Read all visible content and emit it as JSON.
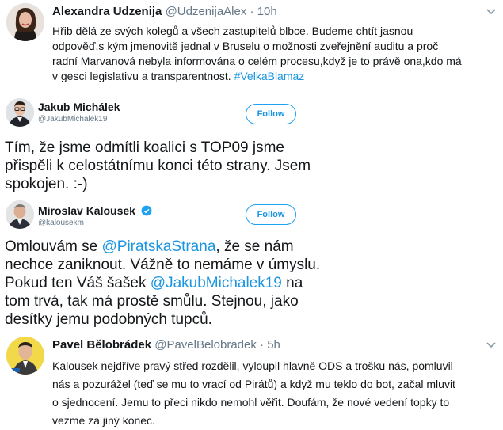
{
  "tweets": [
    {
      "name": "Alexandra Udzenija",
      "handle": "@UdzenijaAlex",
      "sep": "·",
      "time": "10h",
      "lines": [
        "Hřib dělá ze svých kolegů a všech zastupitelů blbce. Budeme chtít jasnou",
        "odpověď,s kým jmenovitě jednal v Bruselu o možnosti zveřejnění auditu a proč",
        "radní Marvanová nebyla informována o celém procesu,když je to právě ona,kdo má"
      ],
      "last_line_pre": "v gesci legislativu a transparentnost. ",
      "hashtag": "#VelkaBlamaz"
    },
    {
      "name": "Jakub Michálek",
      "handle": "@JakubMichalek19",
      "follow": "Follow",
      "lines": [
        "Tím, že jsme odmítli koalici s TOP09 jsme",
        "přispěli k celostátnímu konci této strany. Jsem",
        "spokojen. :-)"
      ]
    },
    {
      "name": "Miroslav Kalousek",
      "handle": "@kalousekm",
      "follow": "Follow",
      "line1_pre": "Omlouvám se ",
      "line1_mention": "@PiratskaStrana",
      "line1_post": ", že se nám",
      "line2": "nechce zaniknout. Vážně to nemáme v úmyslu.",
      "line3_pre": "Pokud ten Váš šašek ",
      "line3_mention": "@JakubMichalek19",
      "line3_post": " na",
      "line4": "tom trvá, tak má prostě smůlu. Stejnou, jako",
      "line5": "desítky jemu podobných tupců."
    },
    {
      "name": "Pavel Bělobrádek",
      "handle": "@PavelBelobradek",
      "sep": "·",
      "time": "5h",
      "lines": [
        "Kalousek nejdříve pravý střed rozdělil, vyloupil hlavně ODS a trošku nás, pomluvil",
        "nás a pozurážel (teď se mu to vrací od Pirátů) a když mu teklo do bot, začal mluvit",
        "o sjednocení. Jemu to přeci nikdo nemohl věřit. Doufám, že nové vedení topky to",
        "vezme za jiný konec."
      ]
    }
  ],
  "colors": {
    "link": "#1b95e0",
    "muted": "#657786",
    "text": "#14171a",
    "verified": "#1da1f2"
  },
  "icons": [
    "chevron-down-icon",
    "verified-badge-icon",
    "avatar"
  ]
}
